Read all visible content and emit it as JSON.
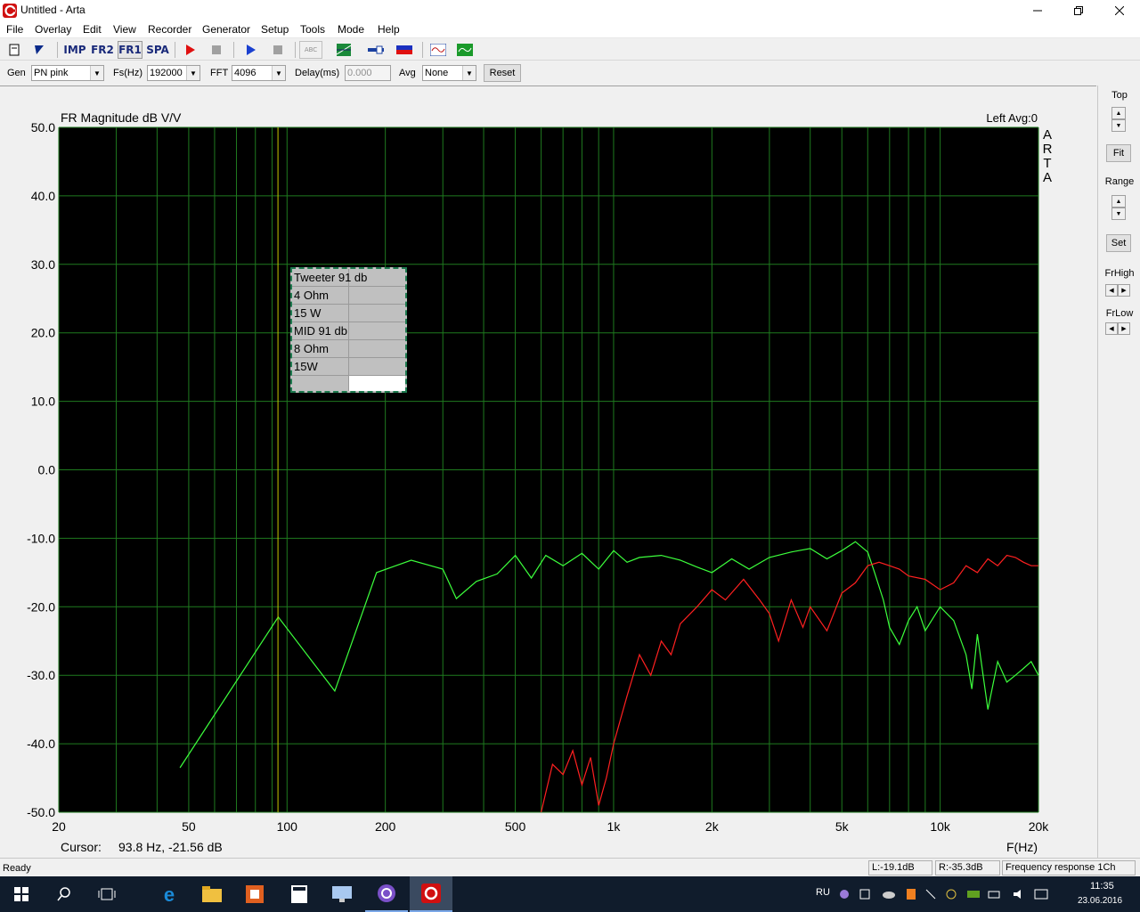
{
  "window": {
    "title": "Untitled - Arta",
    "minimize_icon": "minimize-icon",
    "maximize_icon": "restore-icon",
    "close_icon": "close-icon"
  },
  "menu": [
    "File",
    "Overlay",
    "Edit",
    "View",
    "Recorder",
    "Generator",
    "Setup",
    "Tools",
    "Mode",
    "Help"
  ],
  "toolbar": {
    "buttons": [
      {
        "name": "new-file-icon"
      },
      {
        "name": "open-icon"
      },
      {
        "label": "IMP"
      },
      {
        "label": "FR2"
      },
      {
        "label": "FR1"
      },
      {
        "label": "SPA"
      },
      {
        "name": "record-icon"
      },
      {
        "name": "stop-icon"
      },
      {
        "name": "play-icon"
      },
      {
        "name": "stop2-icon"
      },
      {
        "label": "ABC"
      },
      {
        "name": "grid-icon"
      },
      {
        "name": "slider-icon"
      },
      {
        "name": "color-icon"
      },
      {
        "name": "wave-icon"
      },
      {
        "name": "scope-icon"
      }
    ]
  },
  "controls": {
    "gen_label": "Gen",
    "gen_value": "PN pink",
    "fs_label": "Fs(Hz)",
    "fs_value": "192000",
    "fft_label": "FFT",
    "fft_value": "4096",
    "delay_label": "Delay(ms)",
    "delay_value": "0.000",
    "avg_label": "Avg",
    "avg_value": "None",
    "reset_label": "Reset"
  },
  "right_panel": {
    "top_label": "Top",
    "fit_label": "Fit",
    "range_label": "Range",
    "set_label": "Set",
    "frhigh_label": "FrHigh",
    "frlow_label": "FrLow"
  },
  "legend": [
    "Tweeter 91 db",
    "4 Ohm",
    "15 W",
    "MID 91 db",
    "8 Ohm",
    "15W",
    ""
  ],
  "status": {
    "ready": "Ready",
    "left_level": "L:-19.1dB",
    "right_level": "R:-35.3dB",
    "mode": "Frequency response 1Ch"
  },
  "taskbar": {
    "lang": "RU",
    "time": "11:35",
    "date": "23.06.2016"
  },
  "colors": {
    "plot_bg": "#000000",
    "grid": "#1f7a1f",
    "green_trace": "#3cff3c",
    "red_trace": "#ff2020",
    "cursor": "#c8c800"
  },
  "chart_data": {
    "type": "line",
    "title": "FR Magnitude dB V/V",
    "header_right": "Left  Avg:0",
    "watermark": "ARTA",
    "xlabel": "F(Hz)",
    "ylabel": "",
    "x_scale": "log",
    "xlim": [
      20,
      20000
    ],
    "ylim": [
      -50,
      50
    ],
    "x_ticks": [
      "20",
      "50",
      "100",
      "200",
      "500",
      "1k",
      "2k",
      "5k",
      "10k",
      "20k"
    ],
    "y_ticks": [
      "50.0",
      "40.0",
      "30.0",
      "20.0",
      "10.0",
      "0.0",
      "-10.0",
      "-20.0",
      "-30.0",
      "-40.0",
      "-50.0"
    ],
    "cursor": {
      "x": 93.8,
      "y": -21.56,
      "readout_label": "Cursor:",
      "readout": "93.8 Hz, -21.56 dB"
    },
    "grid": true,
    "series": [
      {
        "color": "#3cff3c",
        "x": [
          47,
          94,
          140,
          188,
          240,
          300,
          330,
          380,
          440,
          500,
          560,
          620,
          700,
          800,
          900,
          1000,
          1100,
          1200,
          1400,
          1600,
          1800,
          2000,
          2300,
          2600,
          3000,
          3500,
          4000,
          4500,
          5000,
          5500,
          6000,
          6300,
          6700,
          7000,
          7500,
          8000,
          8500,
          9000,
          10000,
          11000,
          12000,
          12500,
          13000,
          14000,
          15000,
          16000,
          17000,
          18000,
          19000,
          20000
        ],
        "y": [
          -43.5,
          -21.5,
          -32.3,
          -15.0,
          -13.2,
          -14.5,
          -18.8,
          -16.3,
          -15.2,
          -12.5,
          -15.8,
          -12.5,
          -14.0,
          -12.2,
          -14.5,
          -11.8,
          -13.5,
          -12.8,
          -12.5,
          -13.2,
          -14.2,
          -15.0,
          -13.0,
          -14.5,
          -12.8,
          -12.0,
          -11.5,
          -13.0,
          -11.8,
          -10.5,
          -12.0,
          -15.0,
          -19.0,
          -23.0,
          -25.5,
          -22.0,
          -20.0,
          -23.5,
          -20.0,
          -22.0,
          -27.0,
          -32.0,
          -24.0,
          -35.0,
          -28.0,
          -31.0,
          -30.0,
          -29.0,
          -28.0,
          -30.0
        ]
      },
      {
        "color": "#ff2020",
        "x": [
          600,
          650,
          700,
          750,
          800,
          850,
          900,
          950,
          1000,
          1100,
          1200,
          1300,
          1400,
          1500,
          1600,
          1800,
          2000,
          2200,
          2500,
          2800,
          3000,
          3200,
          3500,
          3800,
          4000,
          4500,
          5000,
          5500,
          6000,
          6500,
          7000,
          7500,
          8000,
          9000,
          10000,
          11000,
          12000,
          13000,
          14000,
          15000,
          16000,
          17000,
          18000,
          19000,
          20000
        ],
        "y": [
          -50.0,
          -43.0,
          -44.5,
          -41.0,
          -46.0,
          -42.0,
          -49.0,
          -45.0,
          -40.0,
          -33.0,
          -27.0,
          -30.0,
          -25.0,
          -27.0,
          -22.5,
          -20.0,
          -17.5,
          -19.0,
          -16.0,
          -19.0,
          -21.0,
          -25.0,
          -19.0,
          -23.0,
          -20.0,
          -23.5,
          -18.0,
          -16.5,
          -14.0,
          -13.5,
          -14.0,
          -14.5,
          -15.5,
          -16.0,
          -17.5,
          -16.5,
          -14.0,
          -15.0,
          -13.0,
          -14.0,
          -12.5,
          -12.8,
          -13.5,
          -14.0,
          -14.0
        ]
      }
    ]
  }
}
